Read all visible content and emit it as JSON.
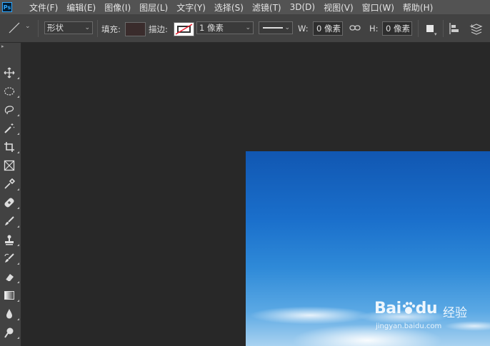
{
  "app": {
    "logo": "Ps"
  },
  "menu": [
    "文件(F)",
    "编辑(E)",
    "图像(I)",
    "图层(L)",
    "文字(Y)",
    "选择(S)",
    "滤镜(T)",
    "3D(D)",
    "视图(V)",
    "窗口(W)",
    "帮助(H)"
  ],
  "options": {
    "tool_icon": "line-tool-icon",
    "mode_value": "形状",
    "fill_label": "填充:",
    "fill_color": "#3a2c2c",
    "stroke_label": "描边:",
    "stroke_width_value": "1 像素",
    "w_label": "W:",
    "w_value": "0 像素",
    "h_label": "H:",
    "h_value": "0 像素"
  },
  "tools": [
    "move-tool-icon",
    "elliptical-marquee-icon",
    "lasso-icon",
    "magic-wand-icon",
    "crop-icon",
    "frame-icon",
    "eyedropper-icon",
    "healing-brush-icon",
    "brush-icon",
    "clone-stamp-icon",
    "history-brush-icon",
    "eraser-icon",
    "gradient-icon",
    "blur-icon",
    "dodge-icon"
  ],
  "watermark": {
    "brand": "Bai",
    "brand2": "du",
    "cn": "经验",
    "url": "jingyan.baidu.com"
  }
}
